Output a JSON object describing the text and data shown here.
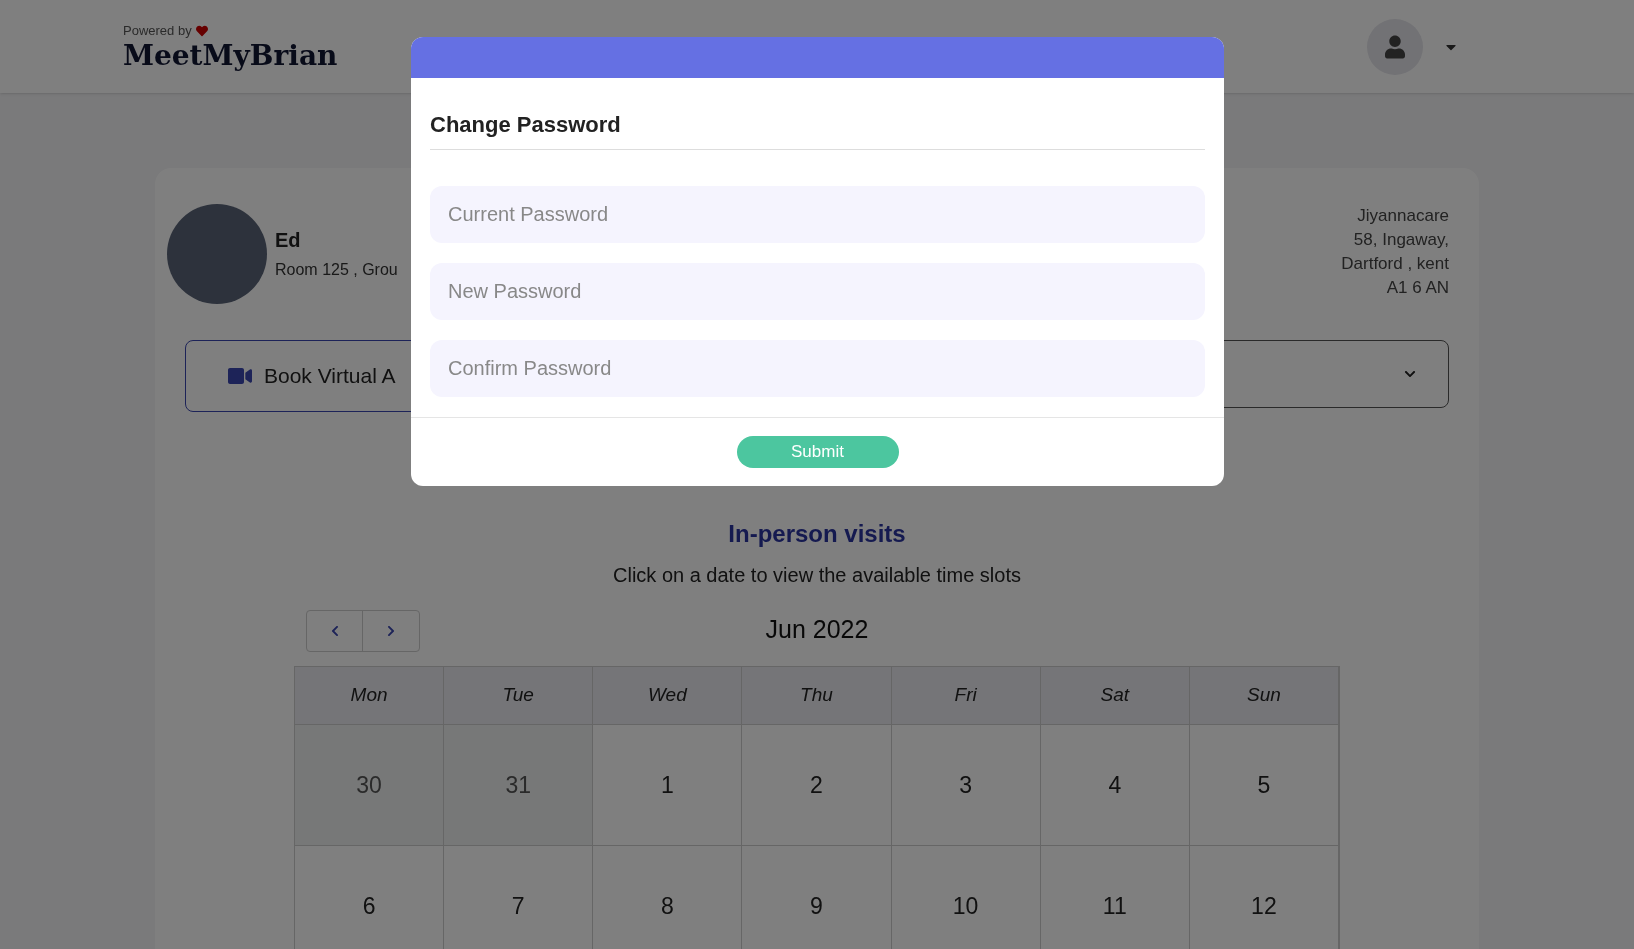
{
  "header": {
    "powered_by": "Powered by",
    "logo": "MeetMyBrian"
  },
  "resident": {
    "name": "Ed",
    "room": "Room 125 , Grou"
  },
  "address": [
    "Jiyannacare",
    "58, Ingaway,",
    "Dartford , kent",
    "A1 6 AN"
  ],
  "book_button": "Book Virtual A",
  "section_title": "In-person visits",
  "instructions": "Click on a date to view the available time slots",
  "calendar": {
    "month": "Jun 2022",
    "weekdays": [
      "Mon",
      "Tue",
      "Wed",
      "Thu",
      "Fri",
      "Sat",
      "Sun"
    ],
    "weeks": [
      [
        {
          "day": "30",
          "outside": true
        },
        {
          "day": "31",
          "outside": true
        },
        {
          "day": "1",
          "outside": false
        },
        {
          "day": "2",
          "outside": false
        },
        {
          "day": "3",
          "outside": false
        },
        {
          "day": "4",
          "outside": false
        },
        {
          "day": "5",
          "outside": false
        }
      ],
      [
        {
          "day": "6",
          "outside": false
        },
        {
          "day": "7",
          "outside": false
        },
        {
          "day": "8",
          "outside": false
        },
        {
          "day": "9",
          "outside": false
        },
        {
          "day": "10",
          "outside": false
        },
        {
          "day": "11",
          "outside": false
        },
        {
          "day": "12",
          "outside": false
        }
      ]
    ]
  },
  "modal": {
    "title": "Change Password",
    "fields": [
      {
        "placeholder": "Current Password"
      },
      {
        "placeholder": "New Password"
      },
      {
        "placeholder": "Confirm Password"
      }
    ],
    "submit": "Submit"
  }
}
